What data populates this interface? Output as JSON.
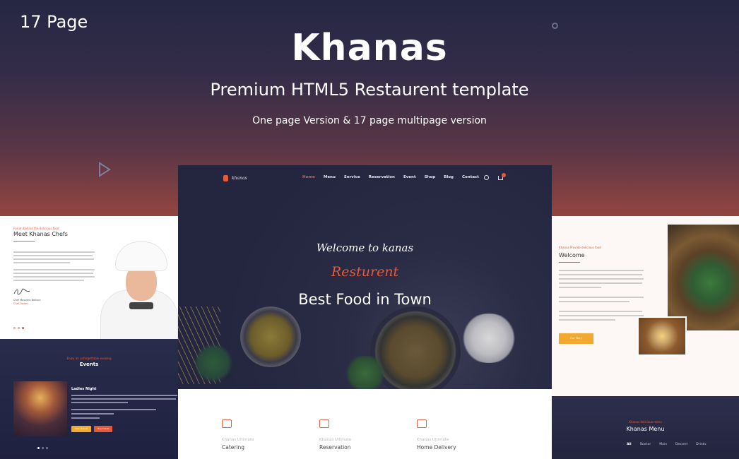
{
  "header": {
    "pages_badge": "17 Page",
    "title": "Khanas",
    "subtitle": "Premium HTML5 Restaurent template",
    "tagline": "One page Version & 17 page multipage version"
  },
  "main_preview": {
    "logo": "khanas",
    "menu": [
      "Home",
      "Menu",
      "Service",
      "Reservation",
      "Event",
      "Shop",
      "Blog",
      "Contact"
    ],
    "active_menu": "Home",
    "welcome": "Welcome to kanas",
    "script_word": "Resturent",
    "headline": "Best Food in Town",
    "features": [
      {
        "kicker": "Khanas Ultimate",
        "title": "Catering"
      },
      {
        "kicker": "Khanas Ultimate",
        "title": "Reservation"
      },
      {
        "kicker": "Khanas Ultimate",
        "title": "Home Delivery"
      }
    ]
  },
  "left_top_preview": {
    "kicker": "Forum behind the delicious food",
    "title": "Meet Khanas Chefs",
    "signer_name": "Chef Massimo Bottura",
    "signer_role": "Chef Owner"
  },
  "left_bottom_preview": {
    "kicker": "Enjoy an unforgettable evening",
    "title": "Events",
    "event_title": "Ladies Night",
    "btn_primary": "View Details",
    "btn_secondary": "Buy Ticket"
  },
  "right_top_preview": {
    "kicker": "Khanas Provide delicious food",
    "title": "Welcome",
    "button": "Our Story"
  },
  "right_bottom_preview": {
    "kicker": "Khanas delicious menu",
    "title": "Khanas Menu",
    "tabs": [
      "All",
      "Starter",
      "Main",
      "Dessert",
      "Drinks"
    ]
  },
  "colors": {
    "accent": "#e35b3b",
    "button_yellow": "#f2a930",
    "dark_navy": "#24253f"
  }
}
